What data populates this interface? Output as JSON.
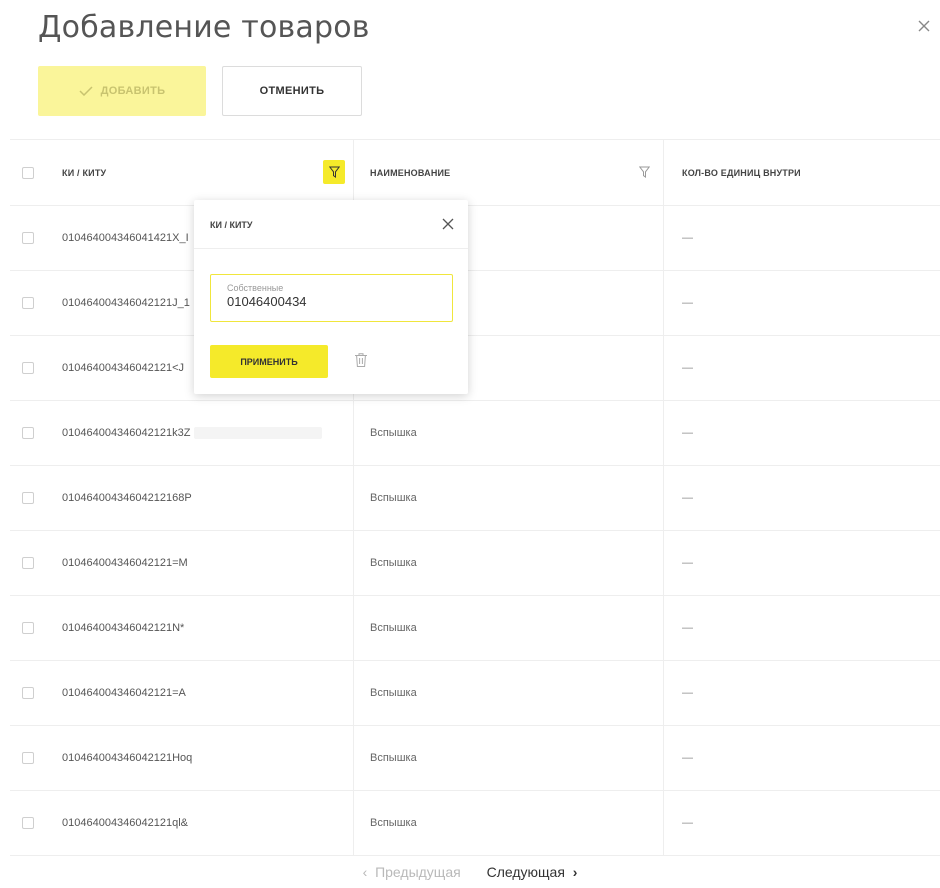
{
  "dialog": {
    "title": "Добавление товаров"
  },
  "toolbar": {
    "add_label": "ДОБАВИТЬ",
    "cancel_label": "ОТМЕНИТЬ"
  },
  "table": {
    "headers": {
      "ki": "КИ / КИТУ",
      "name": "НАИМЕНОВАНИЕ",
      "qty": "КОЛ-ВО ЕДИНИЦ ВНУТРИ"
    },
    "rows": [
      {
        "ki": "010464004346041421X_I",
        "name": "",
        "qty": "—"
      },
      {
        "ki": "010464004346042121J_1",
        "name": "",
        "qty": "—"
      },
      {
        "ki": "010464004346042121<J",
        "name": "",
        "qty": "—"
      },
      {
        "ki": "010464004346042121k3Z",
        "name": "Вспышка",
        "qty": "—"
      },
      {
        "ki": "010464004346042121​68P",
        "name": "Вспышка",
        "qty": "—"
      },
      {
        "ki": "010464004346042121=M",
        "name": "Вспышка",
        "qty": "—"
      },
      {
        "ki": "010464004346042121N*",
        "name": "Вспышка",
        "qty": "—"
      },
      {
        "ki": "010464004346042121=A",
        "name": "Вспышка",
        "qty": "—"
      },
      {
        "ki": "010464004346042121Hoq",
        "name": "Вспышка",
        "qty": "—"
      },
      {
        "ki": "010464004346042121ql&",
        "name": "Вспышка",
        "qty": "—"
      }
    ]
  },
  "filter_popup": {
    "title": "КИ / КИТУ",
    "field_label": "Собственные",
    "field_value": "01046400434",
    "apply_label": "ПРИМЕНИТЬ"
  },
  "pagination": {
    "prev_label": "Предыдущая",
    "next_label": "Следующая"
  },
  "colors": {
    "accent": "#f5ea2a",
    "disabled_button": "#faf59a"
  }
}
